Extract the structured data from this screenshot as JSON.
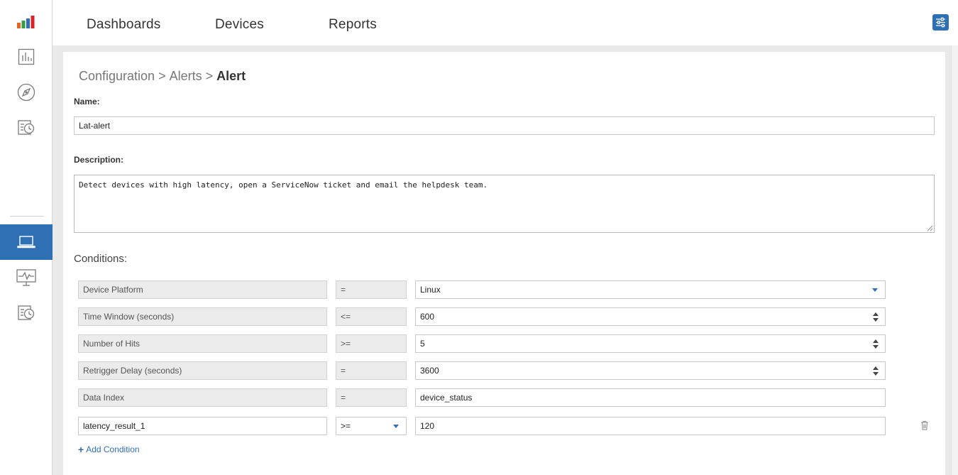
{
  "nav": {
    "tabs": [
      {
        "label": "Dashboards"
      },
      {
        "label": "Devices"
      },
      {
        "label": "Reports"
      }
    ]
  },
  "sidebar": {
    "items": [
      {
        "icon": "brand-logo-icon"
      },
      {
        "icon": "bar-chart-icon"
      },
      {
        "icon": "compass-icon"
      },
      {
        "icon": "schedule-list-icon"
      },
      {
        "icon": "laptop-icon",
        "active": true
      },
      {
        "icon": "monitor-pulse-icon"
      },
      {
        "icon": "schedule-list-icon"
      }
    ]
  },
  "breadcrumb": {
    "items": [
      "Configuration",
      "Alerts"
    ],
    "separator": ">",
    "current": "Alert"
  },
  "form": {
    "name_label": "Name:",
    "name_value": "Lat-alert",
    "description_label": "Description:",
    "description_value": "Detect devices with high latency, open a ServiceNow ticket and email the helpdesk team.",
    "conditions_title": "Conditions:",
    "conditions": [
      {
        "field": "Device Platform",
        "operator": "=",
        "value": "Linux",
        "value_type": "select"
      },
      {
        "field": "Time Window (seconds)",
        "operator": "<=",
        "value": "600",
        "value_type": "number"
      },
      {
        "field": "Number of Hits",
        "operator": ">=",
        "value": "5",
        "value_type": "number"
      },
      {
        "field": "Retrigger Delay (seconds)",
        "operator": "=",
        "value": "3600",
        "value_type": "number"
      },
      {
        "field": "Data Index",
        "operator": "=",
        "value": "device_status",
        "value_type": "text"
      }
    ],
    "custom_condition": {
      "field": "latency_result_1",
      "operator": ">=",
      "value": "120"
    },
    "add_condition_label": "Add Condition",
    "add_condition_symbol": "+"
  },
  "colors": {
    "accent": "#2f6fb3",
    "readonly_bg": "#ebebeb",
    "page_bg": "#e9e9e9"
  }
}
